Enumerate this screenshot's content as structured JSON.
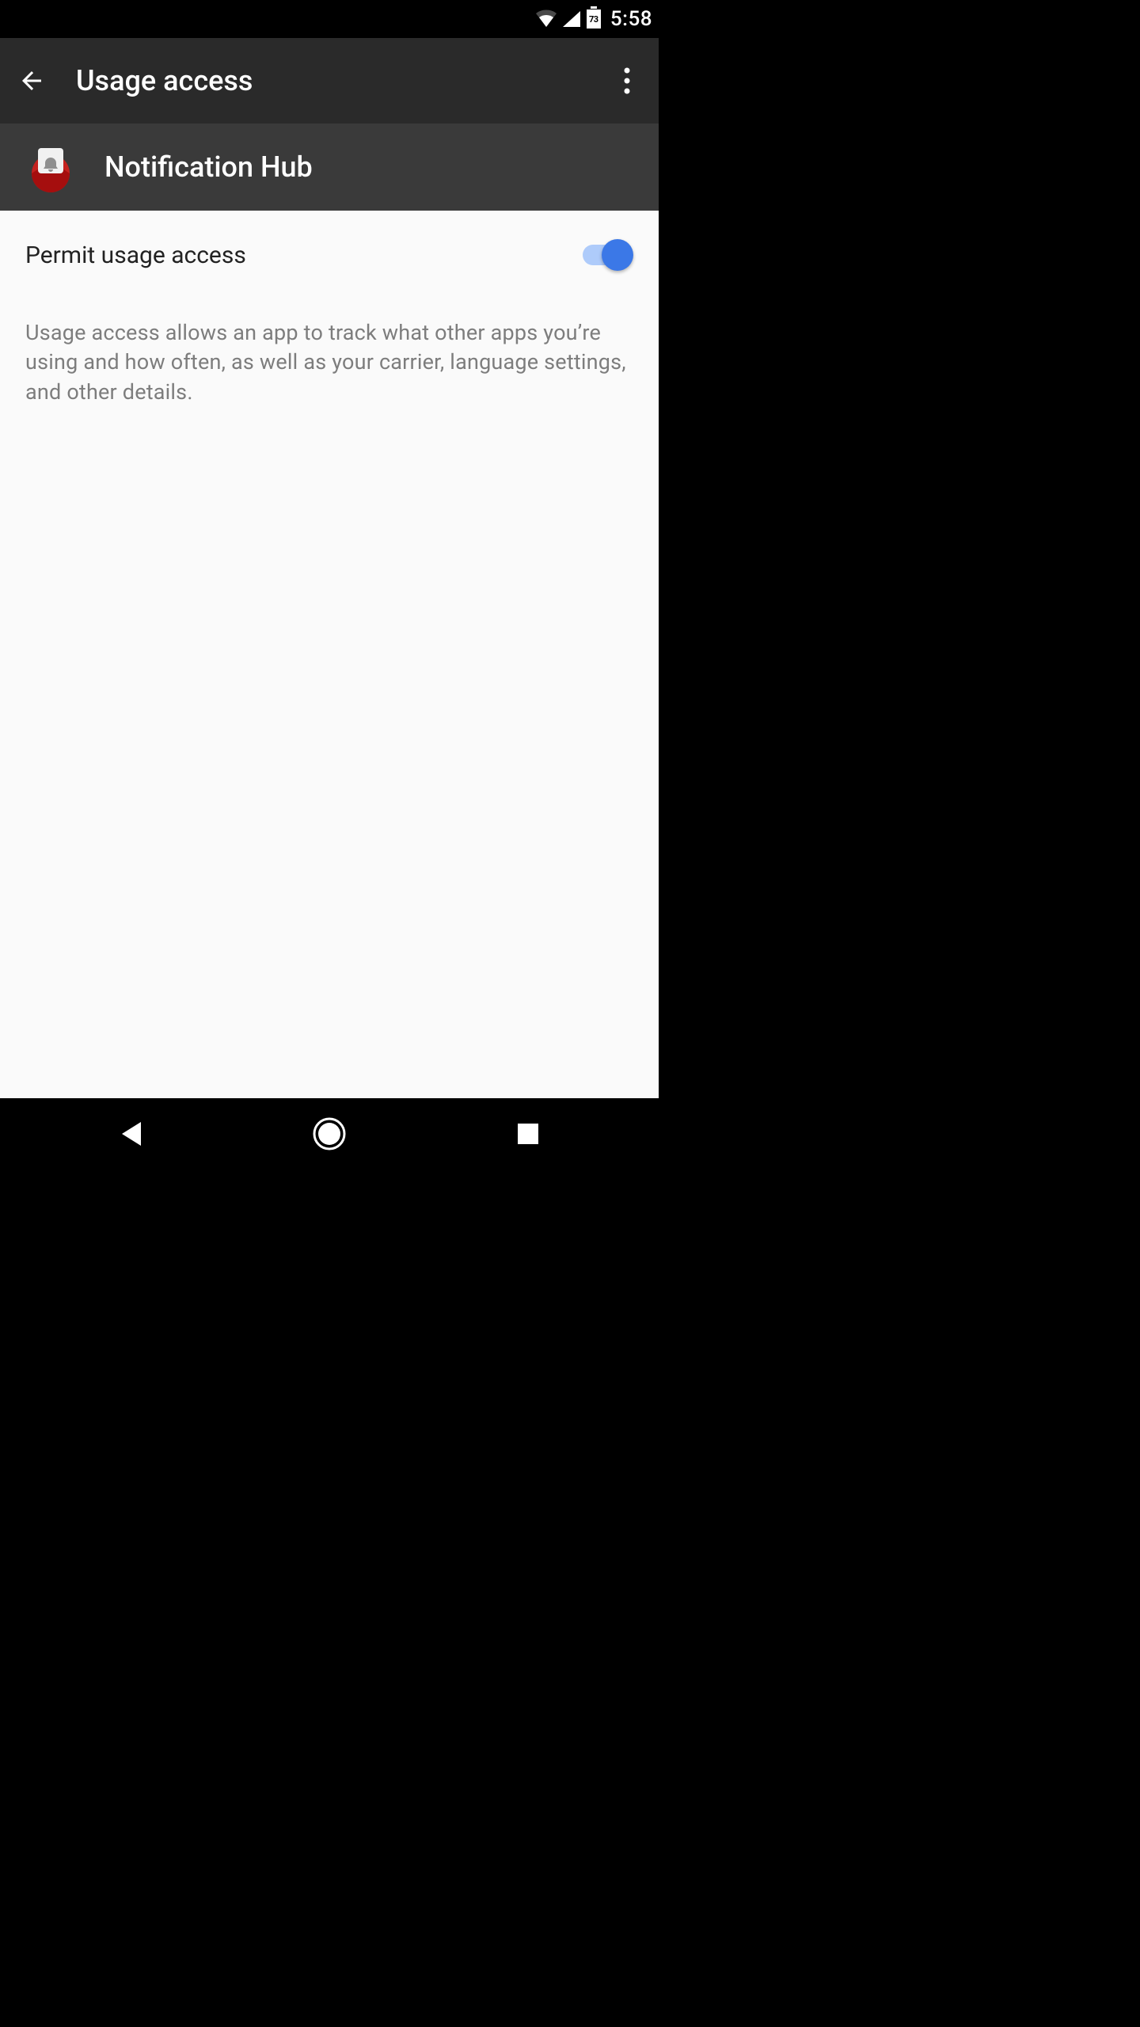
{
  "status_bar": {
    "time": "5:58",
    "battery_percent": "73"
  },
  "app_bar": {
    "title": "Usage access"
  },
  "app_header": {
    "app_name": "Notification Hub"
  },
  "content": {
    "permit_label": "Permit usage access",
    "permit_enabled": true,
    "description": "Usage access allows an app to track what other apps you’re using and how often, as well as your carrier, language settings, and other details."
  },
  "colors": {
    "accent": "#3b78e7",
    "app_icon_primary": "#c5221f"
  }
}
